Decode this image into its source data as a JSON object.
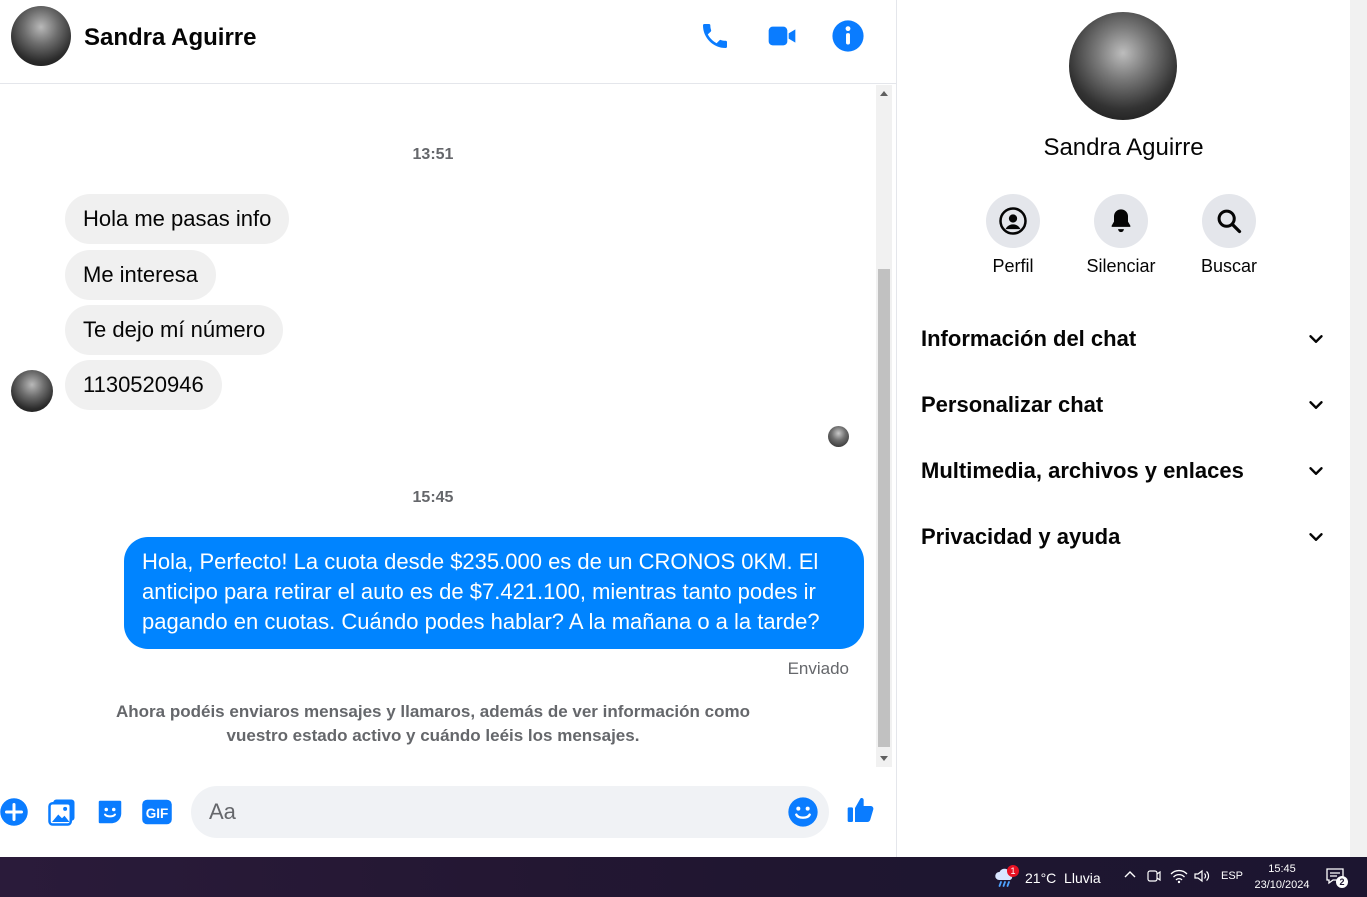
{
  "contact": {
    "name": "Sandra Aguirre"
  },
  "header": {
    "call_icon": "phone-icon",
    "video_icon": "video-camera-icon",
    "info_icon": "info-icon"
  },
  "messages": {
    "timestamp_1": "13:51",
    "incoming": [
      "Hola me pasas info",
      "Me interesa",
      "Te dejo mí número",
      "1130520946"
    ],
    "timestamp_2": "15:45",
    "outgoing": "Hola, Perfecto! La cuota desde $235.000 es de un CRONOS 0KM. El anticipo para retirar el auto es de $7.421.100, mientras tanto podes ir pagando en cuotas. Cuándo podes hablar? A la mañana o a la tarde?",
    "status": "Enviado",
    "info_note": "Ahora podéis enviaros mensajes y llamaros, además de ver información como vuestro estado activo y cuándo leéis los mensajes."
  },
  "composer": {
    "placeholder": "Aa"
  },
  "panel": {
    "actions": [
      {
        "label": "Perfil",
        "icon": "profile-icon"
      },
      {
        "label": "Silenciar",
        "icon": "bell-icon"
      },
      {
        "label": "Buscar",
        "icon": "search-icon"
      }
    ],
    "sections": [
      "Información del chat",
      "Personalizar chat",
      "Multimedia, archivos y enlaces",
      "Privacidad y ayuda"
    ]
  },
  "taskbar": {
    "weather": "21°C  Lluvia",
    "weather_badge": "1",
    "language": "ESP",
    "time": "15:45",
    "date": "23/10/2024",
    "notifications": "2"
  },
  "colors": {
    "accent": "#0084ff",
    "icon_blue": "#0a7cff",
    "bubble_in": "#f0f0f0"
  }
}
